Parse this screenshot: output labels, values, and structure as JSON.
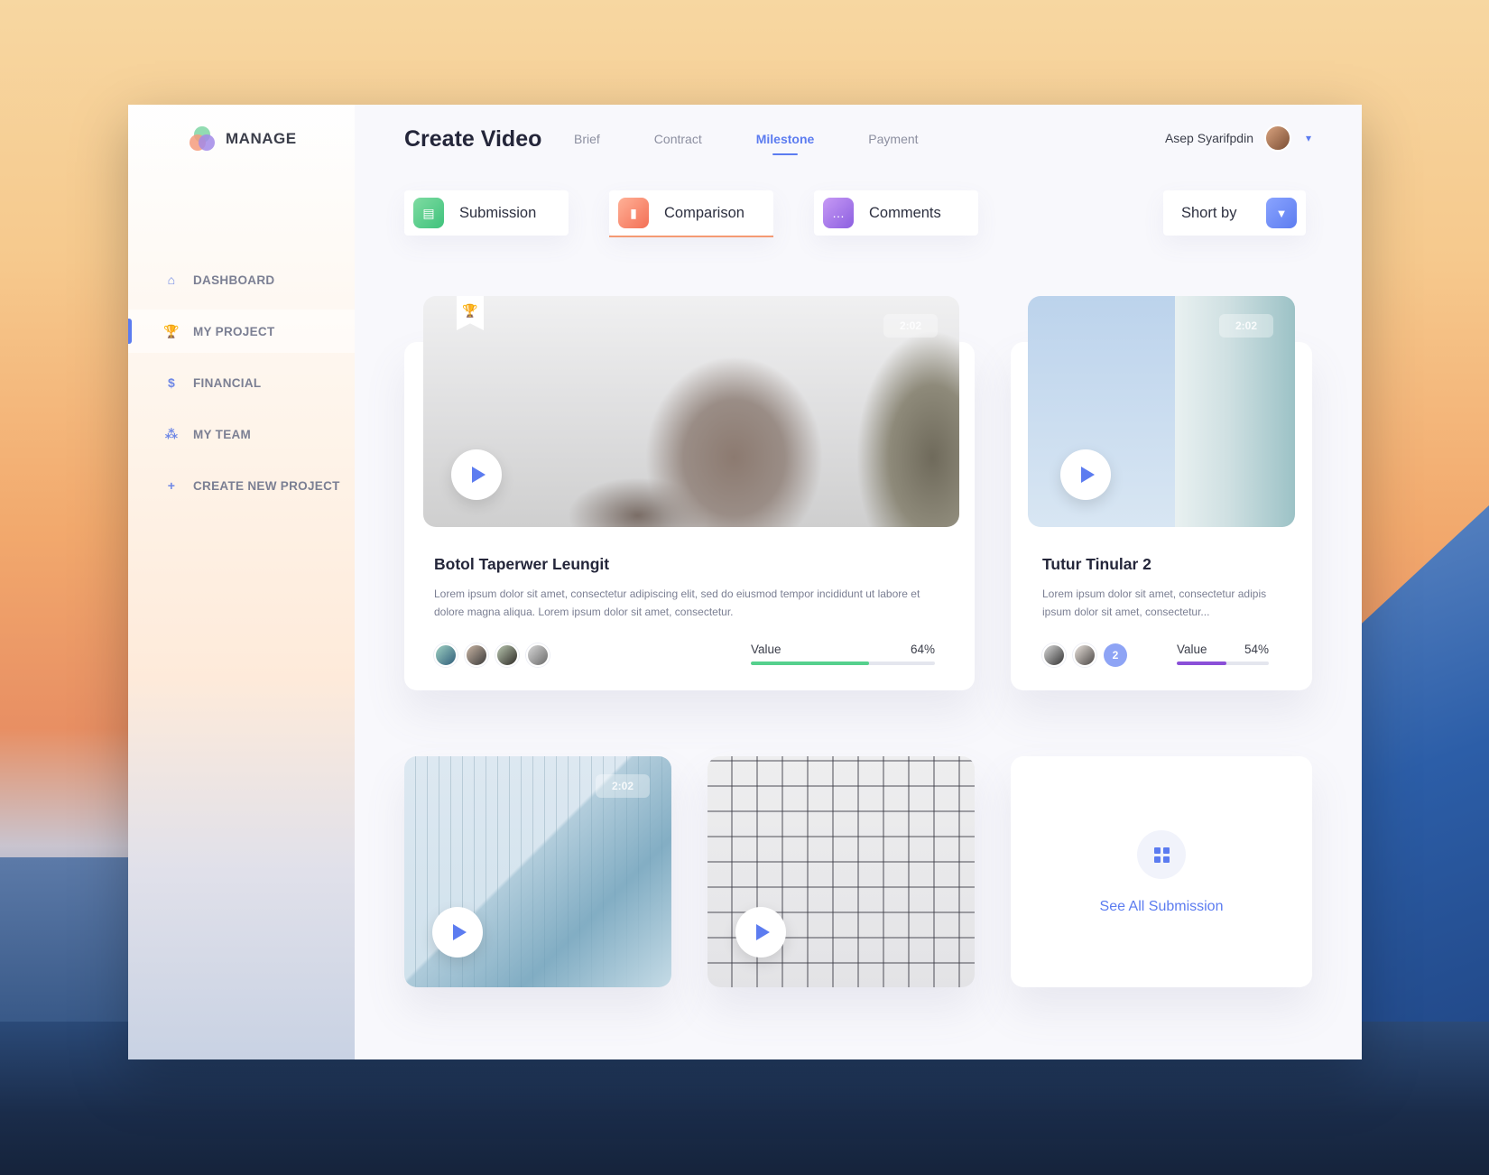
{
  "sidebar": {
    "logo": "MANAGE",
    "items": [
      {
        "label": "DASHBOARD",
        "icon": "home-icon"
      },
      {
        "label": "MY PROJECT",
        "icon": "trophy-icon",
        "active": true
      },
      {
        "label": "FINANCIAL",
        "icon": "dollar-icon"
      },
      {
        "label": "MY TEAM",
        "icon": "team-icon"
      },
      {
        "label": "CREATE NEW PROJECT",
        "icon": "plus-icon"
      }
    ]
  },
  "header": {
    "title": "Create Video",
    "tabs": [
      {
        "label": "Brief"
      },
      {
        "label": "Contract"
      },
      {
        "label": "Milestone",
        "active": true
      },
      {
        "label": "Payment"
      }
    ],
    "user_name": "Asep Syarifpdin"
  },
  "filters": [
    {
      "label": "Submission",
      "icon": "document-icon",
      "color": "#3fc27c"
    },
    {
      "label": "Comparison",
      "icon": "bar-chart-icon",
      "color": "#f36f55",
      "active": true
    },
    {
      "label": "Comments",
      "icon": "chat-icon",
      "color": "#8c5fe0"
    }
  ],
  "sort_label": "Short by",
  "cards": [
    {
      "title": "Botol Taperwer Leungit",
      "description": "Lorem ipsum dolor sit amet, consectetur adipiscing elit, sed do eiusmod tempor incididunt ut labore et dolore magna aliqua. Lorem ipsum dolor sit amet, consectetur.",
      "duration": "2:02",
      "value_label": "Value",
      "value_text": "64%",
      "value": 0.64,
      "bar_color": "#55d08d"
    },
    {
      "title": "Tutur Tinular 2",
      "description": "Lorem ipsum dolor sit amet, consectetur adipis ipsum dolor sit amet, consectetur...",
      "duration": "2:02",
      "value_label": "Value",
      "value_text": "54%",
      "value": 0.54,
      "bar_color": "#8a4fd8",
      "more_count": "2"
    },
    {
      "duration": "2:02"
    }
  ],
  "see_all": "See All Submission",
  "colors": {
    "accent": "#5c7cf0"
  }
}
